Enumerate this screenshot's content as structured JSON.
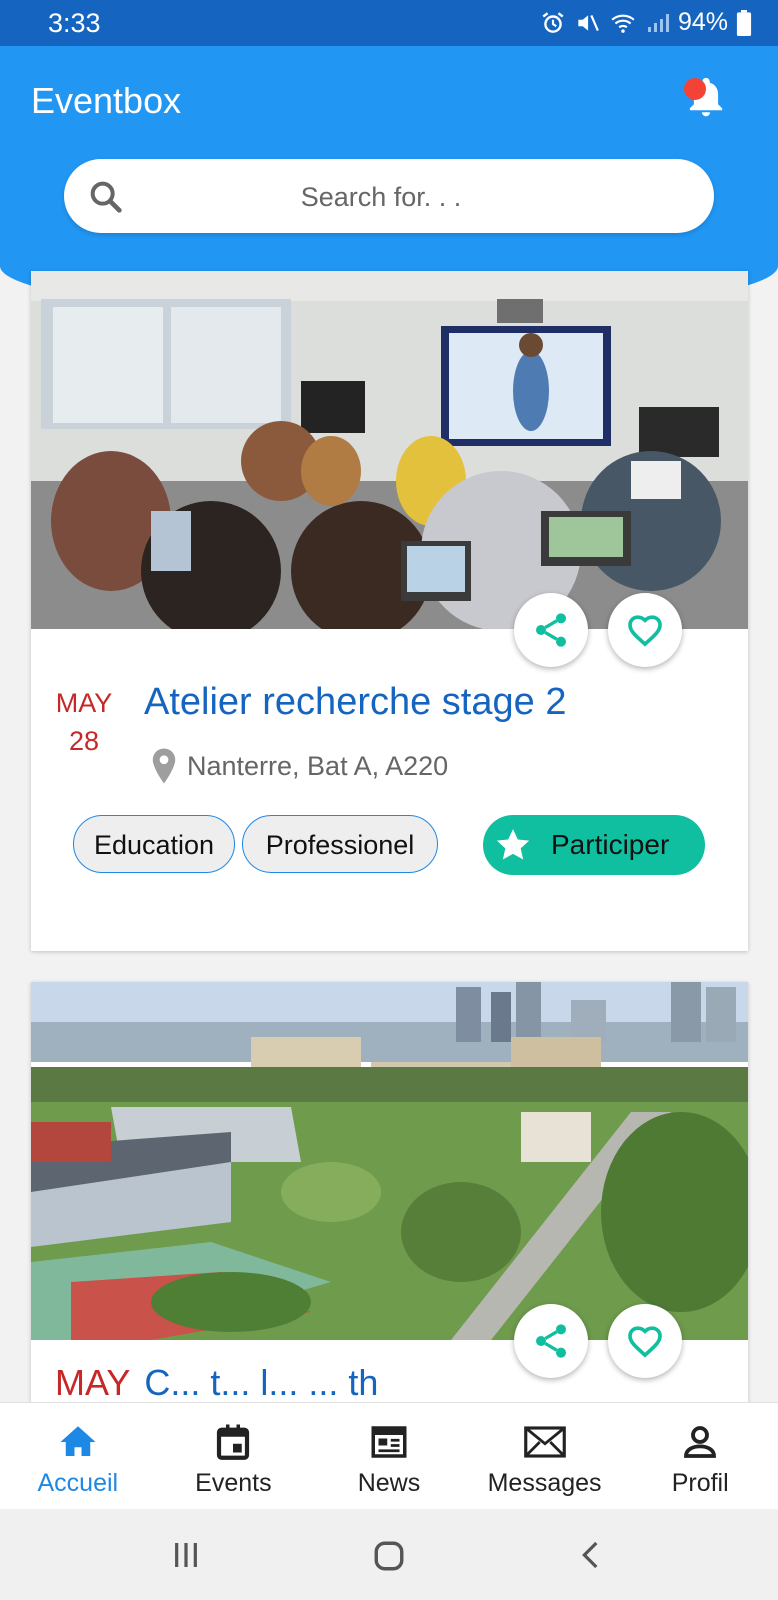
{
  "status_bar": {
    "time": "3:33",
    "battery": "94%"
  },
  "header": {
    "title": "Eventbox"
  },
  "search": {
    "placeholder": "Search for. . ."
  },
  "events": [
    {
      "month": "MAY",
      "day": "28",
      "title": "Atelier recherche stage 2",
      "location": "Nanterre, Bat A, A220",
      "tags": [
        "Education",
        "Professionel"
      ],
      "action_label": "Participer"
    },
    {
      "month": "MAY",
      "title_partial": "C... t... l... ... th"
    }
  ],
  "bottom_nav": [
    {
      "label": "Accueil",
      "icon": "home-icon",
      "active": true
    },
    {
      "label": "Events",
      "icon": "calendar-icon"
    },
    {
      "label": "News",
      "icon": "newspaper-icon"
    },
    {
      "label": "Messages",
      "icon": "mail-icon"
    },
    {
      "label": "Profil",
      "icon": "person-icon"
    }
  ],
  "colors": {
    "primary": "#2196f3",
    "status_bar": "#1565c0",
    "title_blue": "#1565c0",
    "date_red": "#c62828",
    "accent_teal": "#0fbf9f",
    "notification_dot": "#f44336"
  }
}
